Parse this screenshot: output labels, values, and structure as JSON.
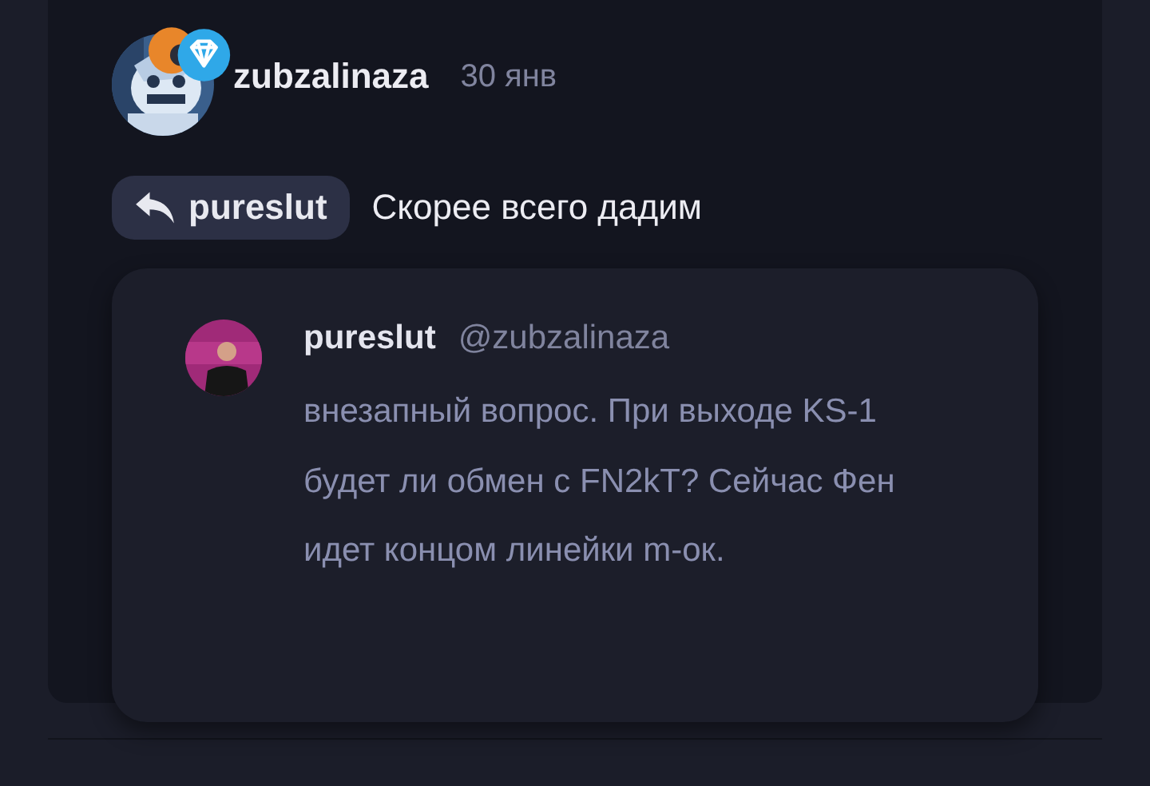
{
  "post": {
    "author": "zubzalinaza",
    "date": "30 янв",
    "reply_to": {
      "author": "pureslut"
    },
    "text": "Скорее всего дадим",
    "quote": {
      "author": "pureslut",
      "mention": "@zubzalinaza",
      "text": "внезапный вопрос. При выходе KS-1 будет ли обмен с FN2kT? Сейчас Фен идет концом линейки m-ок."
    }
  }
}
